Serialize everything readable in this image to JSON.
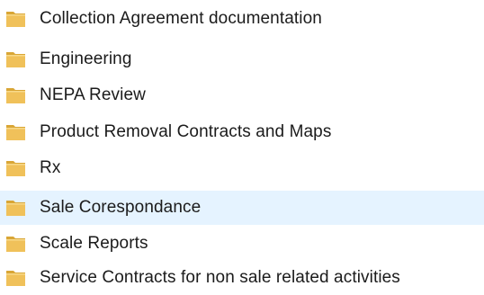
{
  "folders": [
    {
      "label": "Collection Agreement documentation",
      "icon": "folder-icon",
      "selected": false
    },
    {
      "label": "Engineering",
      "icon": "folder-icon",
      "selected": false
    },
    {
      "label": "NEPA Review",
      "icon": "folder-icon",
      "selected": false
    },
    {
      "label": "Product Removal Contracts and Maps",
      "icon": "folder-icon",
      "selected": false
    },
    {
      "label": "Rx",
      "icon": "folder-icon",
      "selected": false
    },
    {
      "label": "Sale Corespondance",
      "icon": "folder-icon",
      "selected": true
    },
    {
      "label": "Scale Reports",
      "icon": "folder-icon",
      "selected": false
    },
    {
      "label": "Service Contracts for non sale related activities",
      "icon": "folder-icon",
      "selected": false
    }
  ],
  "colors": {
    "selection_background": "#e5f3ff",
    "folder_body": "#f0c15a",
    "folder_dark": "#d9a636",
    "text": "#1b1b1b"
  }
}
